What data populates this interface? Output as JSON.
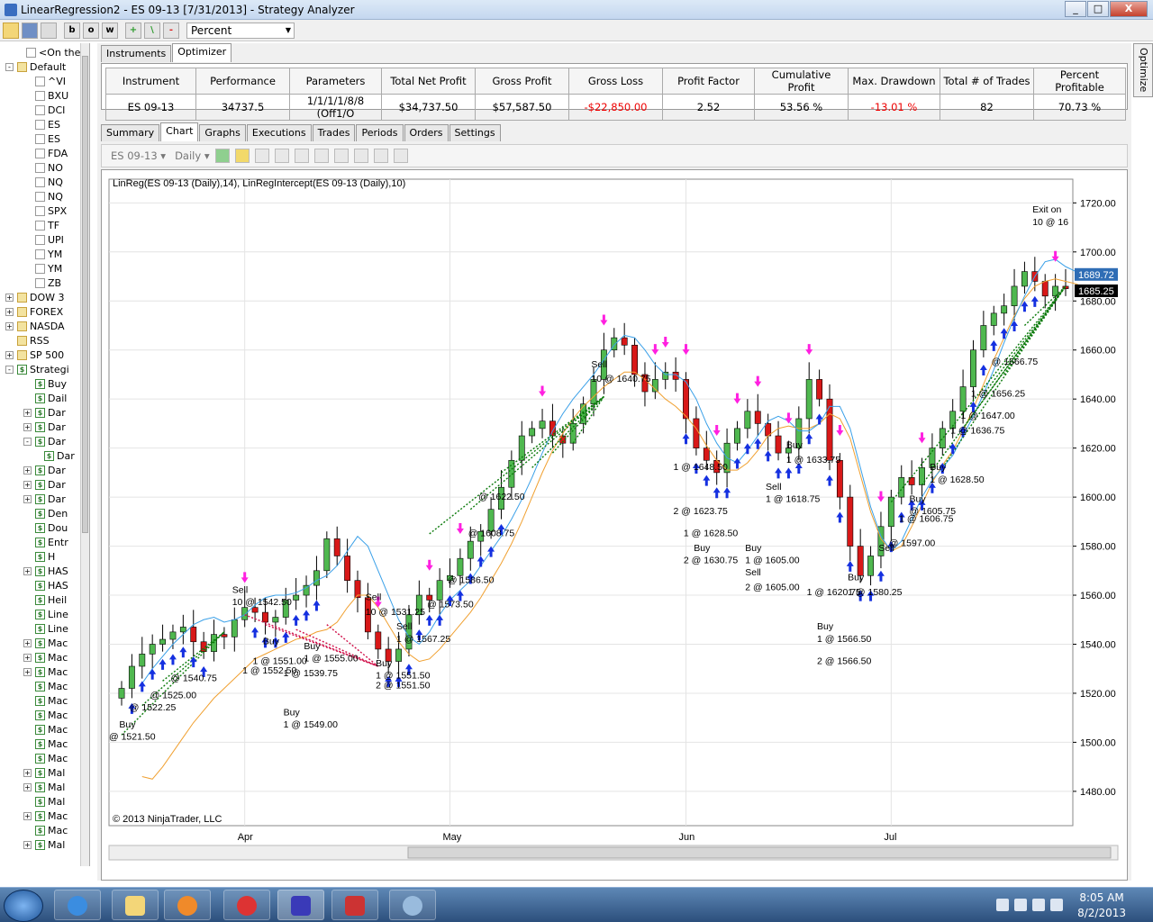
{
  "window": {
    "title": "LinearRegression2 - ES 09-13 [7/31/2013] - Strategy Analyzer",
    "minimize": "_",
    "maximize": "□",
    "close": "X"
  },
  "toolbar": {
    "buttons": [
      "b",
      "o",
      "w",
      "+",
      "\\",
      "-"
    ],
    "display_unit": "Percent"
  },
  "sidebar": {
    "items": [
      {
        "label": "<On the",
        "indent": 1,
        "icon": "chart",
        "exp": ""
      },
      {
        "label": "Default",
        "indent": 0,
        "icon": "folder",
        "exp": "-"
      },
      {
        "label": "^VI",
        "indent": 2,
        "icon": "chart",
        "exp": ""
      },
      {
        "label": "BXU",
        "indent": 2,
        "icon": "chart",
        "exp": ""
      },
      {
        "label": "DCI",
        "indent": 2,
        "icon": "chart",
        "exp": ""
      },
      {
        "label": "ES",
        "indent": 2,
        "icon": "chart",
        "exp": ""
      },
      {
        "label": "ES",
        "indent": 2,
        "icon": "chart",
        "exp": ""
      },
      {
        "label": "FDA",
        "indent": 2,
        "icon": "chart",
        "exp": ""
      },
      {
        "label": "NO",
        "indent": 2,
        "icon": "chart",
        "exp": ""
      },
      {
        "label": "NQ",
        "indent": 2,
        "icon": "chart",
        "exp": ""
      },
      {
        "label": "NQ",
        "indent": 2,
        "icon": "chart",
        "exp": ""
      },
      {
        "label": "SPX",
        "indent": 2,
        "icon": "chart",
        "exp": ""
      },
      {
        "label": "TF",
        "indent": 2,
        "icon": "chart",
        "exp": ""
      },
      {
        "label": "UPI",
        "indent": 2,
        "icon": "chart",
        "exp": ""
      },
      {
        "label": "YM",
        "indent": 2,
        "icon": "chart",
        "exp": ""
      },
      {
        "label": "YM",
        "indent": 2,
        "icon": "chart",
        "exp": ""
      },
      {
        "label": "ZB",
        "indent": 2,
        "icon": "chart",
        "exp": ""
      },
      {
        "label": "DOW 3",
        "indent": 0,
        "icon": "folder",
        "exp": "+"
      },
      {
        "label": "FOREX",
        "indent": 0,
        "icon": "folder",
        "exp": "+"
      },
      {
        "label": "NASDA",
        "indent": 0,
        "icon": "folder",
        "exp": "+"
      },
      {
        "label": "RSS",
        "indent": 0,
        "icon": "folder",
        "exp": ""
      },
      {
        "label": "SP 500",
        "indent": 0,
        "icon": "folder",
        "exp": "+"
      },
      {
        "label": "Strategi",
        "indent": 0,
        "icon": "doll",
        "exp": "-"
      },
      {
        "label": "Buy",
        "indent": 2,
        "icon": "doll",
        "exp": ""
      },
      {
        "label": "Dail",
        "indent": 2,
        "icon": "doll",
        "exp": ""
      },
      {
        "label": "Dar",
        "indent": 2,
        "icon": "doll",
        "exp": "+"
      },
      {
        "label": "Dar",
        "indent": 2,
        "icon": "doll",
        "exp": "+"
      },
      {
        "label": "Dar",
        "indent": 2,
        "icon": "doll",
        "exp": "-"
      },
      {
        "label": "Dar",
        "indent": 3,
        "icon": "doll",
        "exp": ""
      },
      {
        "label": "Dar",
        "indent": 2,
        "icon": "doll",
        "exp": "+"
      },
      {
        "label": "Dar",
        "indent": 2,
        "icon": "doll",
        "exp": "+"
      },
      {
        "label": "Dar",
        "indent": 2,
        "icon": "doll",
        "exp": "+"
      },
      {
        "label": "Den",
        "indent": 2,
        "icon": "doll",
        "exp": ""
      },
      {
        "label": "Dou",
        "indent": 2,
        "icon": "doll",
        "exp": ""
      },
      {
        "label": "Entr",
        "indent": 2,
        "icon": "doll",
        "exp": ""
      },
      {
        "label": "H",
        "indent": 2,
        "icon": "doll",
        "exp": ""
      },
      {
        "label": "HAS",
        "indent": 2,
        "icon": "doll",
        "exp": "+"
      },
      {
        "label": "HAS",
        "indent": 2,
        "icon": "doll",
        "exp": ""
      },
      {
        "label": "Heil",
        "indent": 2,
        "icon": "doll",
        "exp": ""
      },
      {
        "label": "Line",
        "indent": 2,
        "icon": "doll",
        "exp": ""
      },
      {
        "label": "Line",
        "indent": 2,
        "icon": "doll",
        "exp": ""
      },
      {
        "label": "Mac",
        "indent": 2,
        "icon": "doll",
        "exp": "+"
      },
      {
        "label": "Mac",
        "indent": 2,
        "icon": "doll",
        "exp": "+"
      },
      {
        "label": "Mac",
        "indent": 2,
        "icon": "doll",
        "exp": "+"
      },
      {
        "label": "Mac",
        "indent": 2,
        "icon": "doll",
        "exp": ""
      },
      {
        "label": "Mac",
        "indent": 2,
        "icon": "doll",
        "exp": ""
      },
      {
        "label": "Mac",
        "indent": 2,
        "icon": "doll",
        "exp": ""
      },
      {
        "label": "Mac",
        "indent": 2,
        "icon": "doll",
        "exp": ""
      },
      {
        "label": "Mac",
        "indent": 2,
        "icon": "doll",
        "exp": ""
      },
      {
        "label": "Mac",
        "indent": 2,
        "icon": "doll",
        "exp": ""
      },
      {
        "label": "Mal",
        "indent": 2,
        "icon": "doll",
        "exp": "+"
      },
      {
        "label": "Mal",
        "indent": 2,
        "icon": "doll",
        "exp": "+"
      },
      {
        "label": "Mal",
        "indent": 2,
        "icon": "doll",
        "exp": ""
      },
      {
        "label": "Mac",
        "indent": 2,
        "icon": "doll",
        "exp": "+"
      },
      {
        "label": "Mac",
        "indent": 2,
        "icon": "doll",
        "exp": ""
      },
      {
        "label": "Mal",
        "indent": 2,
        "icon": "doll",
        "exp": "+"
      }
    ]
  },
  "top_tabs": [
    {
      "label": "Instruments",
      "active": false
    },
    {
      "label": "Optimizer",
      "active": true
    }
  ],
  "side_panel": {
    "label": "Optimize"
  },
  "performance": {
    "headers": [
      "Instrument",
      "Performance",
      "Parameters",
      "Total Net Profit",
      "Gross Profit",
      "Gross Loss",
      "Profit Factor",
      "Cumulative Profit",
      "Max. Drawdown",
      "Total # of Trades",
      "Percent Profitable"
    ],
    "row": [
      "ES 09-13",
      "34737.5",
      "1/1/1/1/8/8 (Off1/O",
      "$34,737.50",
      "$57,587.50",
      "-$22,850.00",
      "2.52",
      "53.56 %",
      "-13.01 %",
      "82",
      "70.73 %"
    ],
    "negative_cols": [
      5,
      8
    ]
  },
  "result_tabs": [
    {
      "label": "Summary",
      "active": false
    },
    {
      "label": "Chart",
      "active": true
    },
    {
      "label": "Graphs",
      "active": false
    },
    {
      "label": "Executions",
      "active": false
    },
    {
      "label": "Trades",
      "active": false
    },
    {
      "label": "Periods",
      "active": false
    },
    {
      "label": "Orders",
      "active": false
    },
    {
      "label": "Settings",
      "active": false
    }
  ],
  "chart_toolbar": {
    "instrument": "ES 09-13",
    "interval": "Daily"
  },
  "chart_data": {
    "type": "candlestick",
    "indicator_label": "LinReg(ES 09-13 (Daily),14), LinRegIntercept(ES 09-13 (Daily),10)",
    "copyright": "© 2013 NinjaTrader, LLC",
    "ylim": [
      1466,
      1726
    ],
    "y_ticks": [
      "1480.00",
      "1500.00",
      "1520.00",
      "1540.00",
      "1560.00",
      "1580.00",
      "1600.00",
      "1620.00",
      "1640.00",
      "1660.00",
      "1680.00",
      "1700.00",
      "1720.00"
    ],
    "x_ticks": [
      {
        "label": "Apr",
        "bar": 12
      },
      {
        "label": "May",
        "bar": 32
      },
      {
        "label": "Jun",
        "bar": 55
      },
      {
        "label": "Jul",
        "bar": 75
      }
    ],
    "last_price_labels": [
      {
        "text": "1689.72",
        "value": 1689.72,
        "color": "#2f6db5"
      },
      {
        "text": "1685.25",
        "value": 1685.25,
        "color": "#000000"
      }
    ],
    "close_series": [
      1522,
      1531,
      1536,
      1540,
      1542,
      1545,
      1547,
      1541,
      1537,
      1544,
      1543,
      1550,
      1555,
      1553,
      1549,
      1551,
      1558,
      1560,
      1564,
      1570,
      1583,
      1576,
      1566,
      1559,
      1545,
      1538,
      1533,
      1538,
      1552,
      1560,
      1558,
      1566,
      1568,
      1575,
      1582,
      1586,
      1595,
      1604,
      1615,
      1625,
      1628,
      1631,
      1625,
      1622,
      1630,
      1638,
      1648,
      1660,
      1665,
      1662,
      1650,
      1643,
      1648,
      1651,
      1648,
      1632,
      1620,
      1615,
      1610,
      1622,
      1628,
      1635,
      1630,
      1625,
      1618,
      1620,
      1632,
      1648,
      1640,
      1615,
      1600,
      1580,
      1568,
      1576,
      1588,
      1600,
      1608,
      1605,
      1612,
      1620,
      1628,
      1635,
      1645,
      1660,
      1670,
      1675,
      1678,
      1686,
      1692,
      1688,
      1682,
      1686,
      1685
    ],
    "linreg_blue": {
      "start_bar": 2,
      "values": [
        1524,
        1530,
        1535,
        1540,
        1544,
        1548,
        1550,
        1551,
        1549,
        1550,
        1552,
        1556,
        1559,
        1560,
        1560,
        1561,
        1563,
        1566,
        1568,
        1572,
        1578,
        1584,
        1580,
        1570,
        1560,
        1550,
        1543,
        1540,
        1545,
        1552,
        1558,
        1562,
        1566,
        1572,
        1578,
        1584,
        1591,
        1599,
        1608,
        1618,
        1627,
        1634,
        1640,
        1645,
        1650,
        1656,
        1662,
        1666,
        1665,
        1660,
        1654,
        1650,
        1650,
        1647,
        1640,
        1630,
        1622,
        1616,
        1614,
        1619,
        1625,
        1631,
        1633,
        1631,
        1627,
        1627,
        1630,
        1637,
        1637,
        1628,
        1612,
        1596,
        1584,
        1578,
        1582,
        1591,
        1600,
        1607,
        1612,
        1617,
        1625,
        1633,
        1642,
        1652,
        1663,
        1673,
        1682,
        1690,
        1696,
        1697,
        1694,
        1692,
        1689.72
      ]
    },
    "linreg_intercept_orange": {
      "start_bar": 2,
      "values": [
        1486,
        1485,
        1490,
        1496,
        1502,
        1508,
        1513,
        1518,
        1522,
        1526,
        1530,
        1534,
        1536,
        1538,
        1540,
        1542,
        1543,
        1545,
        1546,
        1549,
        1555,
        1560,
        1560,
        1555,
        1548,
        1541,
        1536,
        1533,
        1534,
        1538,
        1543,
        1548,
        1553,
        1559,
        1566,
        1573,
        1581,
        1590,
        1600,
        1610,
        1619,
        1626,
        1632,
        1637,
        1641,
        1645,
        1648,
        1651,
        1651,
        1648,
        1644,
        1640,
        1637,
        1633,
        1628,
        1621,
        1615,
        1611,
        1611,
        1614,
        1619,
        1625,
        1628,
        1629,
        1628,
        1628,
        1630,
        1634,
        1632,
        1624,
        1609,
        1594,
        1583,
        1578,
        1580,
        1588,
        1597,
        1606,
        1613,
        1619,
        1627,
        1636,
        1646,
        1656,
        1665,
        1674,
        1681,
        1686,
        1688,
        1689,
        1688,
        1687,
        1685.25
      ]
    },
    "trade_annotations": [
      {
        "bar": 0,
        "value": 1501,
        "text": "@ 1521.50"
      },
      {
        "bar": 1,
        "value": 1506,
        "text": "Buy"
      },
      {
        "bar": 2,
        "value": 1513,
        "text": "@ 1522.25"
      },
      {
        "bar": 4,
        "value": 1518,
        "text": "@ 1525.00"
      },
      {
        "bar": 6,
        "value": 1525,
        "text": "@ 1540.75"
      },
      {
        "bar": 12,
        "value": 1561,
        "text": "Sell"
      },
      {
        "bar": 12,
        "value": 1556,
        "text": "10 @ 1542.50"
      },
      {
        "bar": 15,
        "value": 1540,
        "text": "Buy"
      },
      {
        "bar": 14,
        "value": 1532,
        "text": "1 @ 1551.00"
      },
      {
        "bar": 13,
        "value": 1528,
        "text": "1 @ 1552.50"
      },
      {
        "bar": 17,
        "value": 1527,
        "text": "1 @ 1539.75"
      },
      {
        "bar": 17,
        "value": 1511,
        "text": "Buy"
      },
      {
        "bar": 17,
        "value": 1506,
        "text": "1 @ 1549.00"
      },
      {
        "bar": 19,
        "value": 1538,
        "text": "Buy"
      },
      {
        "bar": 19,
        "value": 1533,
        "text": "1 @ 1555.00"
      },
      {
        "bar": 25,
        "value": 1558,
        "text": "Sell"
      },
      {
        "bar": 25,
        "value": 1552,
        "text": "10 @ 1531.25"
      },
      {
        "bar": 26,
        "value": 1531,
        "text": "Buy"
      },
      {
        "bar": 26,
        "value": 1526,
        "text": "1 @ 1551.50"
      },
      {
        "bar": 26,
        "value": 1522,
        "text": "2 @ 1551.50"
      },
      {
        "bar": 28,
        "value": 1546,
        "text": "Sell"
      },
      {
        "bar": 28,
        "value": 1541,
        "text": "1 @ 1567.25"
      },
      {
        "bar": 31,
        "value": 1555,
        "text": "@ 1573.50"
      },
      {
        "bar": 33,
        "value": 1565,
        "text": "@ 1586.50"
      },
      {
        "bar": 35,
        "value": 1584,
        "text": "@ 1608.75"
      },
      {
        "bar": 36,
        "value": 1599,
        "text": "@ 1622.50"
      },
      {
        "bar": 47,
        "value": 1653,
        "text": "Sell"
      },
      {
        "bar": 47,
        "value": 1647,
        "text": "10 @ 1640.75"
      },
      {
        "bar": 55,
        "value": 1611,
        "text": "1 @ 1648.50"
      },
      {
        "bar": 55,
        "value": 1593,
        "text": "2 @ 1623.75"
      },
      {
        "bar": 56,
        "value": 1584,
        "text": "1 @ 1628.50"
      },
      {
        "bar": 57,
        "value": 1578,
        "text": "Buy"
      },
      {
        "bar": 56,
        "value": 1573,
        "text": "2 @ 1630.75"
      },
      {
        "bar": 62,
        "value": 1578,
        "text": "Buy"
      },
      {
        "bar": 62,
        "value": 1573,
        "text": "1 @ 1605.00"
      },
      {
        "bar": 62,
        "value": 1568,
        "text": "Sell"
      },
      {
        "bar": 62,
        "value": 1562,
        "text": "2 @ 1605.00"
      },
      {
        "bar": 64,
        "value": 1603,
        "text": "Sell"
      },
      {
        "bar": 64,
        "value": 1598,
        "text": "1 @ 1618.75"
      },
      {
        "bar": 66,
        "value": 1620,
        "text": "Buy"
      },
      {
        "bar": 66,
        "value": 1614,
        "text": "1 @ 1633.75"
      },
      {
        "bar": 68,
        "value": 1560,
        "text": "1 @ 1620.75"
      },
      {
        "bar": 69,
        "value": 1546,
        "text": "Buy"
      },
      {
        "bar": 69,
        "value": 1541,
        "text": "1 @ 1566.50"
      },
      {
        "bar": 69,
        "value": 1532,
        "text": "2 @ 1566.50"
      },
      {
        "bar": 72,
        "value": 1566,
        "text": "Buy"
      },
      {
        "bar": 72,
        "value": 1560,
        "text": "1 @ 1580.25"
      },
      {
        "bar": 75,
        "value": 1578,
        "text": "Sell"
      },
      {
        "bar": 76,
        "value": 1580,
        "text": "@ 1597.00"
      },
      {
        "bar": 77,
        "value": 1590,
        "text": "1 @ 1606.75"
      },
      {
        "bar": 78,
        "value": 1598,
        "text": "Buy"
      },
      {
        "bar": 78,
        "value": 1593,
        "text": "@ 1605.75"
      },
      {
        "bar": 80,
        "value": 1611,
        "text": "Buy"
      },
      {
        "bar": 80,
        "value": 1606,
        "text": "1 @ 1628.50"
      },
      {
        "bar": 82,
        "value": 1626,
        "text": "1 @ 1636.75"
      },
      {
        "bar": 83,
        "value": 1632,
        "text": "1 @ 1647.00"
      },
      {
        "bar": 84,
        "value": 1641,
        "text": "1 @ 1656.25"
      },
      {
        "bar": 86,
        "value": 1654,
        "text": "@ 1666.75"
      },
      {
        "bar": 90,
        "value": 1716,
        "text": "Exit on"
      },
      {
        "bar": 90,
        "value": 1711,
        "text": "10 @ 16"
      }
    ],
    "pink_arrows": [
      12,
      25,
      30,
      33,
      41,
      47,
      52,
      53,
      55,
      58,
      60,
      62,
      65,
      67,
      70,
      74,
      78,
      91
    ],
    "blue_arrow_bars": [
      1,
      2,
      3,
      4,
      5,
      6,
      7,
      8,
      13,
      14,
      15,
      16,
      17,
      18,
      19,
      26,
      27,
      28,
      29,
      30,
      31,
      32,
      33,
      34,
      35,
      36,
      37,
      55,
      56,
      57,
      58,
      59,
      60,
      61,
      62,
      63,
      64,
      65,
      66,
      67,
      68,
      69,
      70,
      71,
      72,
      73,
      74,
      75,
      76,
      77,
      78,
      79,
      80,
      81,
      82,
      83,
      84,
      85,
      86,
      87,
      88,
      89
    ]
  },
  "taskbar": {
    "time": "8:05 AM",
    "date": "8/2/2013"
  }
}
